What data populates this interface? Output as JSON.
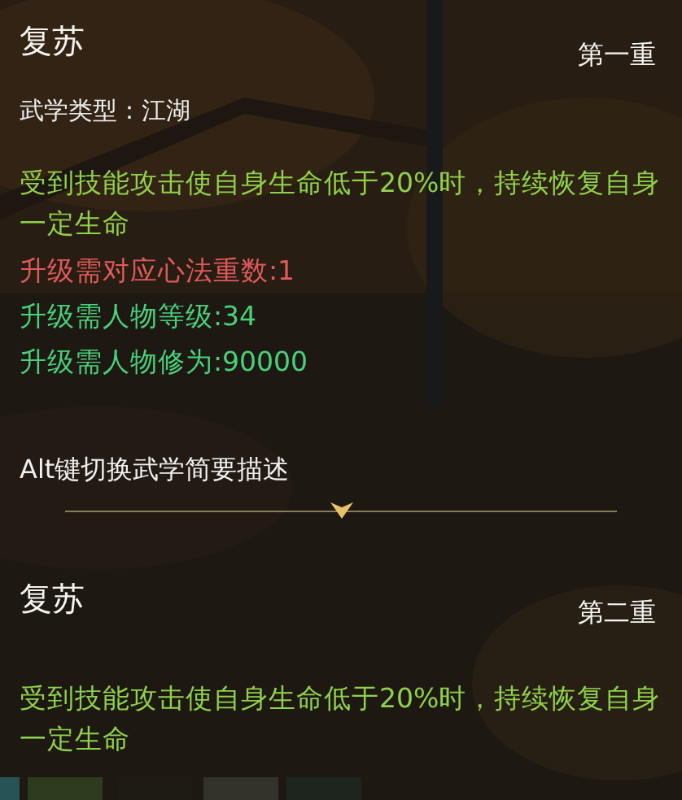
{
  "sections": [
    {
      "title": "复苏",
      "rank": "第一重",
      "type_label": "武学类型：江湖",
      "description": "受到技能攻击使自身生命低于20%时，持续恢复自身一定生命",
      "requirements": [
        {
          "text": "升级需对应心法重数:1",
          "met": false
        },
        {
          "text": "升级需人物等级:34",
          "met": true
        },
        {
          "text": "升级需人物修为:90000",
          "met": true
        }
      ],
      "hint": "Alt键切换武学简要描述"
    },
    {
      "title": "复苏",
      "rank": "第二重",
      "description": "受到技能攻击使自身生命低于20%时，持续恢复自身一定生命"
    }
  ]
}
